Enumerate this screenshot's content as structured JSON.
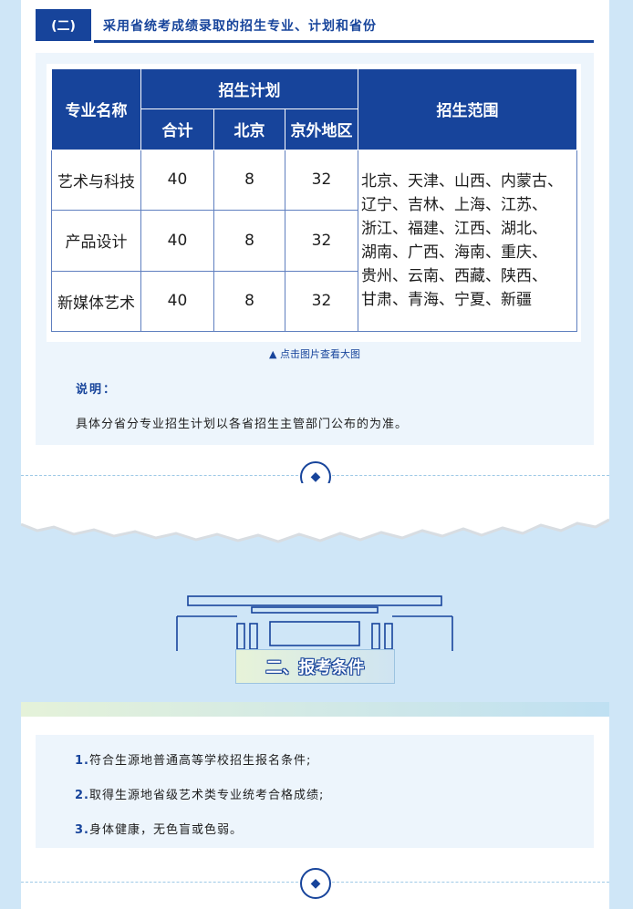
{
  "section_plan": {
    "badge": "(二)",
    "title": "采用省统考成绩录取的招生专业、计划和省份"
  },
  "plan_table": {
    "headers": {
      "major": "专业名称",
      "plan": "招生计划",
      "total": "合计",
      "beijing": "北京",
      "outside": "京外地区",
      "range": "招生范围"
    },
    "rows": [
      {
        "major": "艺术与科技",
        "total": "40",
        "beijing": "8",
        "outside": "32"
      },
      {
        "major": "产品设计",
        "total": "40",
        "beijing": "8",
        "outside": "32"
      },
      {
        "major": "新媒体艺术",
        "total": "40",
        "beijing": "8",
        "outside": "32"
      }
    ],
    "range_lines": [
      "北京、天津、山西、内蒙古、",
      "辽宁、吉林、上海、江苏、",
      "浙江、福建、江西、湖北、",
      "湖南、广西、海南、重庆、",
      "贵州、云南、西藏、陕西、",
      "甘肃、青海、宁夏、新疆"
    ]
  },
  "click_hint": "▲ 点击图片查看大图",
  "note": {
    "title": "说明：",
    "body": "具体分省分专业招生计划以各省招生主管部门公布的为准。"
  },
  "section_conditions": {
    "title": "二、报考条件",
    "items": [
      {
        "num": "1.",
        "text": "符合生源地普通高等学校招生报名条件;"
      },
      {
        "num": "2.",
        "text": "取得生源地省级艺术类专业统考合格成绩;"
      },
      {
        "num": "3.",
        "text": "身体健康，无色盲或色弱。"
      }
    ]
  },
  "colors": {
    "brand_blue": "#17449b",
    "page_background": "#cfe6f7",
    "panel_background": "#edf5fc"
  }
}
